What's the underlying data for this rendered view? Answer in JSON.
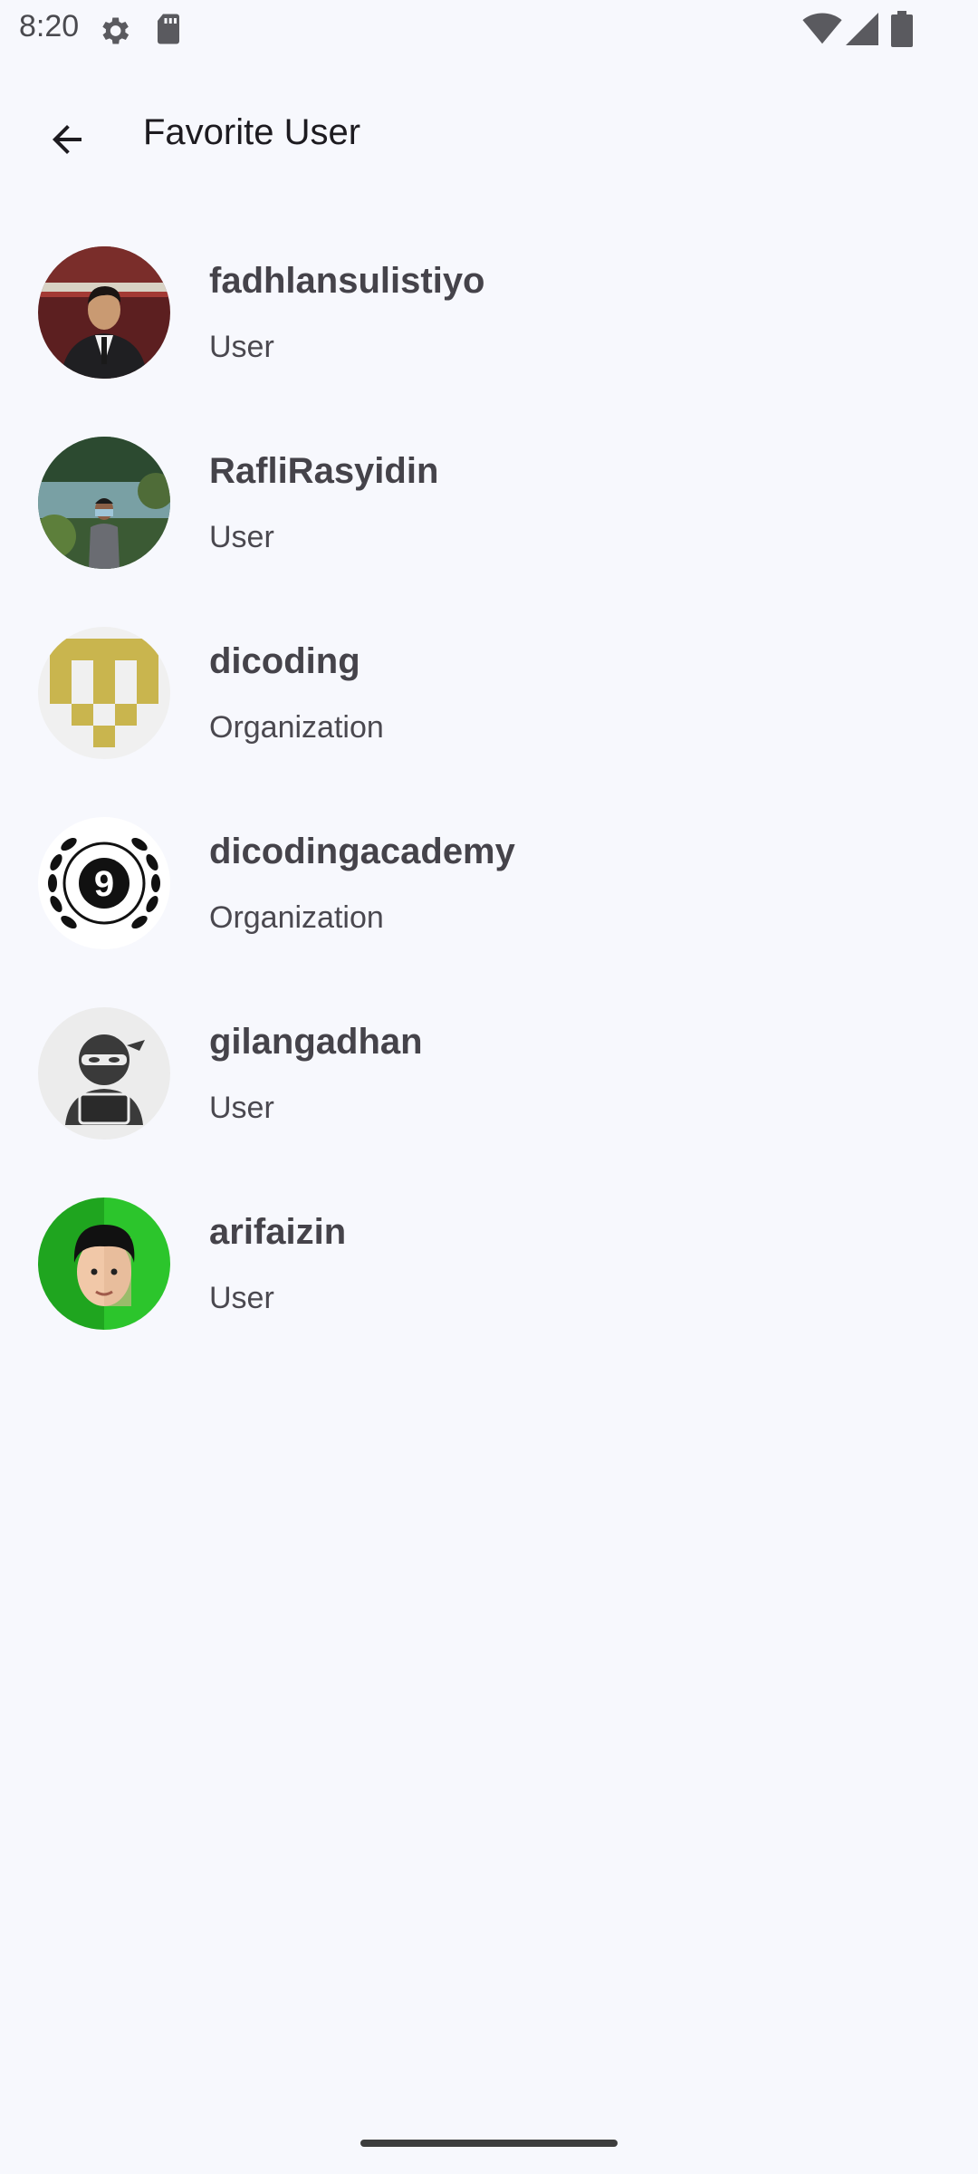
{
  "status_bar": {
    "time": "8:20",
    "icons": [
      "gear-icon",
      "sd-card-icon",
      "wifi-icon",
      "signal-icon",
      "battery-icon"
    ]
  },
  "app_bar": {
    "back_icon": "arrow-back-icon",
    "title": "Favorite User"
  },
  "list": {
    "items": [
      {
        "login": "fadhlansulistiyo",
        "type": "User",
        "avatar": "photo-man-in-suit"
      },
      {
        "login": "RafliRasyidin",
        "type": "User",
        "avatar": "photo-man-at-lake"
      },
      {
        "login": "dicoding",
        "type": "Organization",
        "avatar": "identicon-gold"
      },
      {
        "login": "dicodingacademy",
        "type": "Organization",
        "avatar": "dicoding-academy-logo"
      },
      {
        "login": "gilangadhan",
        "type": "User",
        "avatar": "ninja-hacker"
      },
      {
        "login": "arifaizin",
        "type": "User",
        "avatar": "cartoon-boy-green"
      }
    ]
  },
  "colors": {
    "background": "#f7f8fd",
    "title": "#1d1b20",
    "text": "#45434a"
  }
}
